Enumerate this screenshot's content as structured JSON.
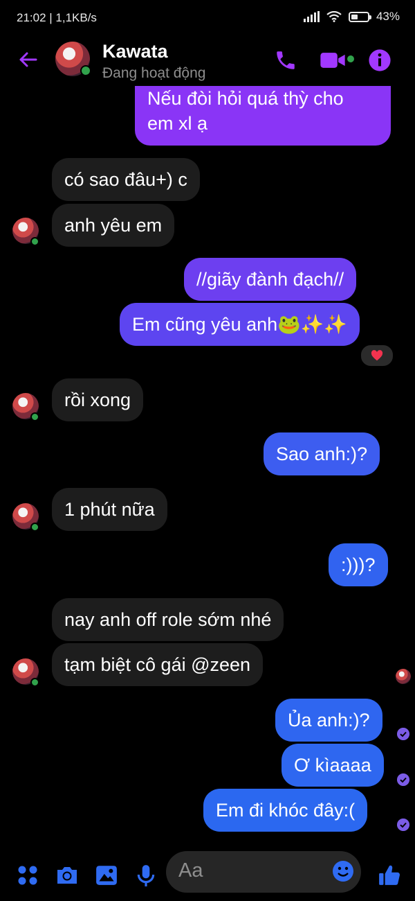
{
  "status_bar": {
    "time_speed": "21:02 | 1,1KB/s",
    "battery": "43%",
    "battery_level": 0.43
  },
  "header": {
    "name": "Kawata",
    "status": "Đang hoạt động"
  },
  "messages": [
    {
      "text": "Nếu đòi hỏi quá thỳ cho",
      "text2": "em xl ạ",
      "side": "out"
    },
    {
      "text": "có sao đâu+) c",
      "side": "in"
    },
    {
      "text": "anh yêu em",
      "side": "in"
    },
    {
      "text": "//giãy đành đạch//",
      "side": "out"
    },
    {
      "text": "Em cũng yêu anh🐸✨✨",
      "side": "out",
      "reaction": "heart"
    },
    {
      "text": "rồi xong",
      "side": "in"
    },
    {
      "text": "Sao anh:)?",
      "side": "out"
    },
    {
      "text": "1 phút nữa",
      "side": "in"
    },
    {
      "text": ":)))?",
      "side": "out"
    },
    {
      "text": "nay anh off role sớm nhé",
      "side": "in"
    },
    {
      "text": "tạm biệt cô gái @zeen",
      "side": "in"
    },
    {
      "text": "Ủa anh:)?",
      "side": "out"
    },
    {
      "text": "Ơ kìaaaa",
      "side": "out"
    },
    {
      "text": "Em đi khóc đây:(",
      "side": "out"
    }
  ],
  "composer": {
    "placeholder": "Aa"
  },
  "colors": {
    "accent": "#a238ff",
    "bubble_top": "#8b3df2",
    "bubble_bottom": "#2f65f0",
    "incoming_bg": "#1d1d1d"
  }
}
